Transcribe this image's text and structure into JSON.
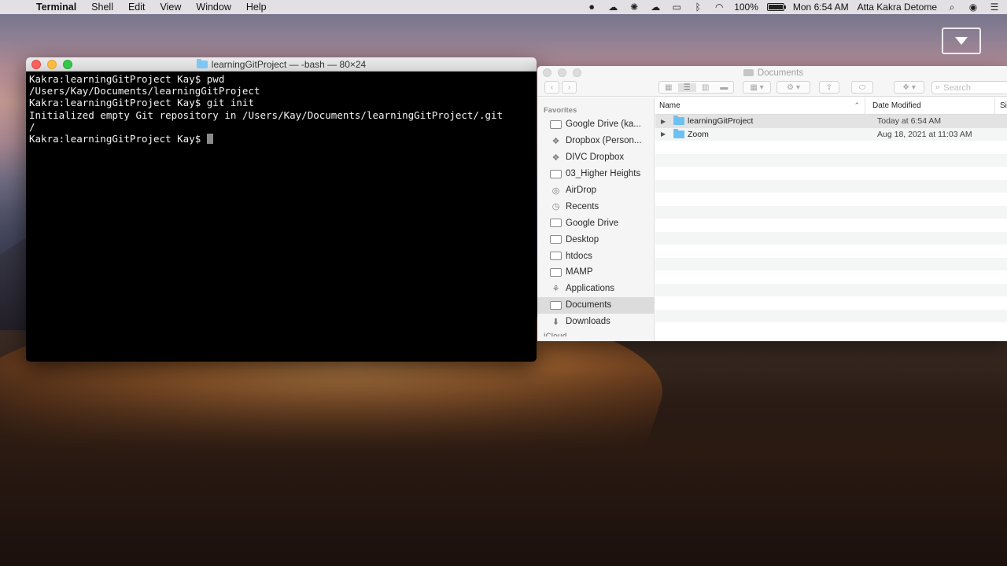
{
  "menubar": {
    "app_name": "Terminal",
    "menus": [
      "Shell",
      "Edit",
      "View",
      "Window",
      "Help"
    ],
    "battery_percent": "100%",
    "clock": "Mon 6:54 AM",
    "user": "Atta Kakra Detome",
    "battery_fill": 1.0
  },
  "terminal": {
    "title": "learningGitProject — -bash — 80×24",
    "lines": [
      "Kakra:learningGitProject Kay$ pwd",
      "/Users/Kay/Documents/learningGitProject",
      "Kakra:learningGitProject Kay$ git init",
      "Initialized empty Git repository in /Users/Kay/Documents/learningGitProject/.git",
      "/",
      "Kakra:learningGitProject Kay$ "
    ]
  },
  "finder": {
    "title": "Documents",
    "search_placeholder": "Search",
    "sidebar": {
      "section_favorites": "Favorites",
      "items": [
        {
          "label": "Google Drive (ka...",
          "icon": "folder-icon"
        },
        {
          "label": "Dropbox (Person...",
          "icon": "dropbox-icon"
        },
        {
          "label": "DIVC Dropbox",
          "icon": "dropbox-icon"
        },
        {
          "label": "03_Higher Heights",
          "icon": "folder-icon"
        },
        {
          "label": "AirDrop",
          "icon": "airdrop-icon"
        },
        {
          "label": "Recents",
          "icon": "clock-icon"
        },
        {
          "label": "Google Drive",
          "icon": "folder-icon"
        },
        {
          "label": "Desktop",
          "icon": "folder-icon"
        },
        {
          "label": "htdocs",
          "icon": "folder-icon"
        },
        {
          "label": "MAMP",
          "icon": "folder-icon"
        },
        {
          "label": "Applications",
          "icon": "applications-icon"
        },
        {
          "label": "Documents",
          "icon": "documents-icon",
          "selected": true
        },
        {
          "label": "Downloads",
          "icon": "downloads-icon"
        }
      ],
      "section_icloud": "iCloud"
    },
    "columns": {
      "name": "Name",
      "date_modified": "Date Modified",
      "size": "Si"
    },
    "files": [
      {
        "name": "learningGitProject",
        "date": "Today at 6:54 AM"
      },
      {
        "name": "Zoom",
        "date": "Aug 18, 2021 at 11:03 AM"
      }
    ]
  },
  "colors": {
    "terminal_bg": "#000000",
    "terminal_text": "#f2f2f2",
    "folder_blue": "#6ec0f3",
    "close_red": "#fc605c",
    "minimize_yellow": "#fdbc40",
    "zoom_green": "#34c84a"
  }
}
